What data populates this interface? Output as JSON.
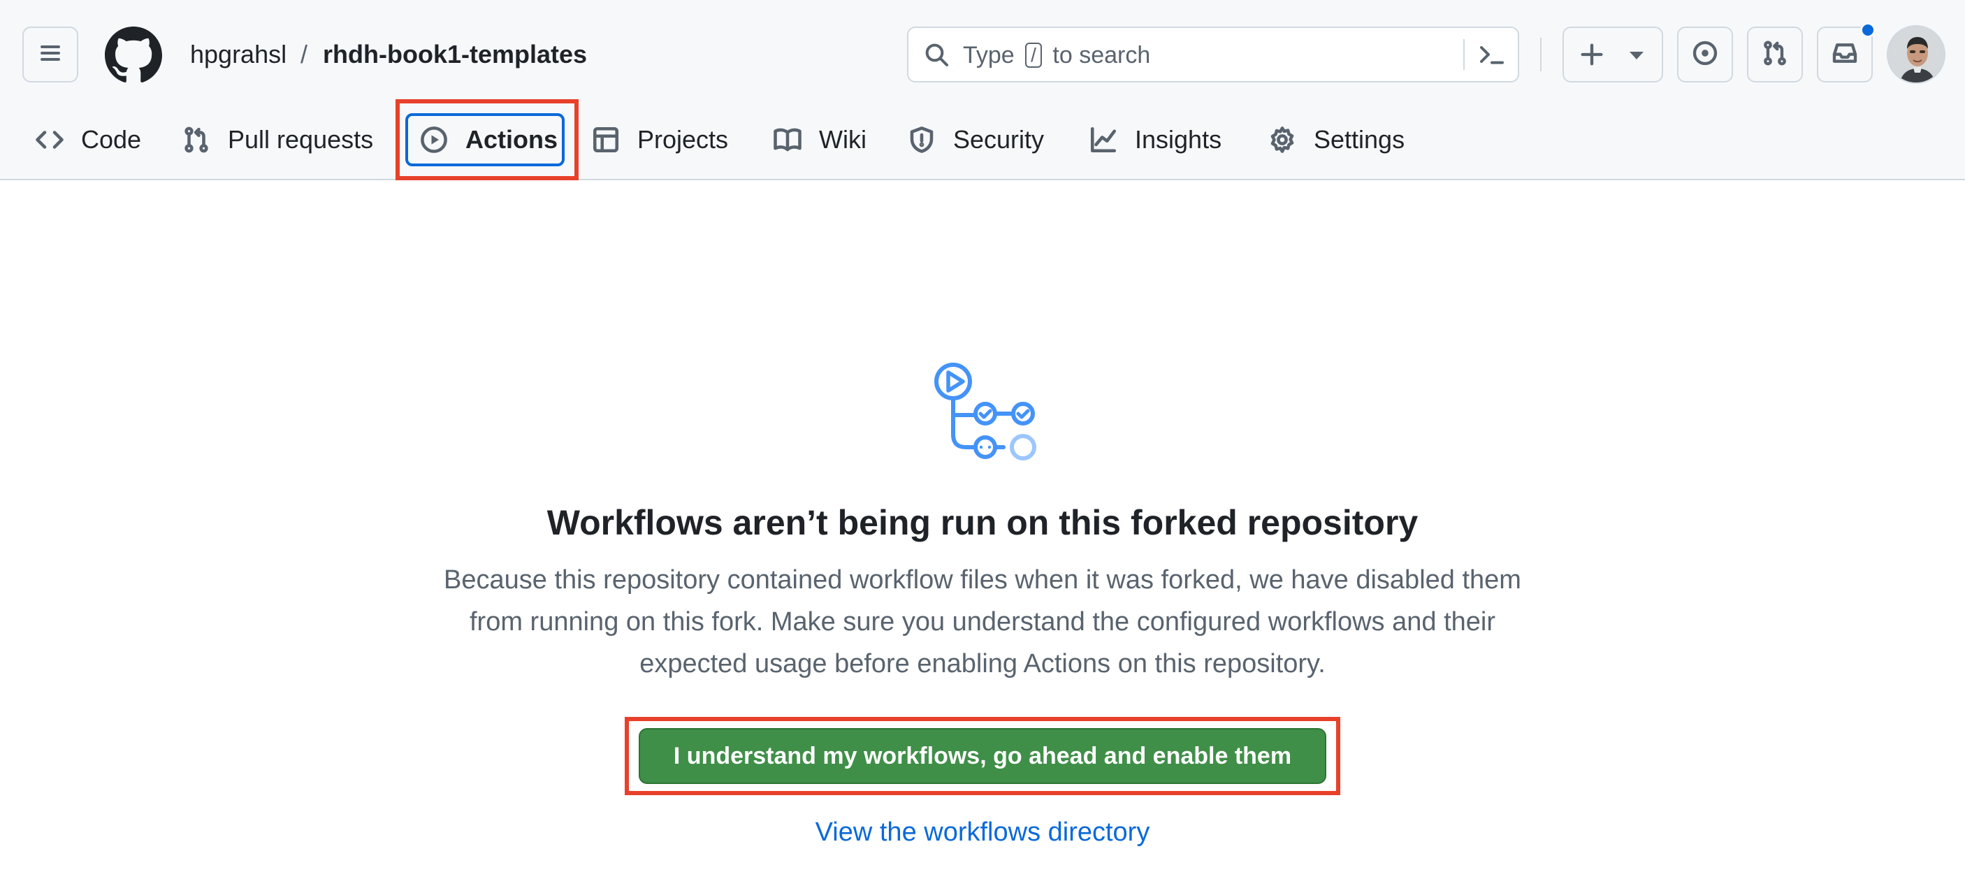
{
  "header": {
    "owner": "hpgrahsl",
    "separator": "/",
    "repo": "rhdh-book1-templates",
    "search": {
      "prefix": "Type",
      "key": "/",
      "suffix": "to search"
    },
    "icons": {
      "menu": "hamburger-icon",
      "logo": "github-mark-icon",
      "search": "search-icon",
      "command": "command-palette-icon",
      "create": "plus-icon",
      "issues": "issue-opened-icon",
      "pulls": "git-pull-request-icon",
      "inbox": "inbox-icon"
    },
    "notification_color": "#0969da"
  },
  "nav": {
    "items": [
      {
        "label": "Code",
        "icon": "code-icon",
        "selected": false
      },
      {
        "label": "Pull requests",
        "icon": "git-pull-request-icon",
        "selected": false
      },
      {
        "label": "Actions",
        "icon": "play-icon",
        "selected": true
      },
      {
        "label": "Projects",
        "icon": "table-icon",
        "selected": false
      },
      {
        "label": "Wiki",
        "icon": "book-icon",
        "selected": false
      },
      {
        "label": "Security",
        "icon": "shield-icon",
        "selected": false
      },
      {
        "label": "Insights",
        "icon": "graph-icon",
        "selected": false
      },
      {
        "label": "Settings",
        "icon": "gear-icon",
        "selected": false
      }
    ]
  },
  "main": {
    "illustration": "workflow-graph-icon",
    "title": "Workflows aren’t being run on this forked repository",
    "description_lines": [
      "Because this repository contained workflow files when it was forked, we have disabled them",
      "from running on this fork. Make sure you understand the configured workflows and their",
      "expected usage before enabling Actions on this repository."
    ],
    "enable_button": "I understand my workflows, go ahead and enable them",
    "directory_link": "View the workflows directory"
  },
  "colors": {
    "primary_button": "#3f8f48",
    "link": "#0969da",
    "highlight_box": "#e8402a",
    "focus_outline": "#0969da"
  }
}
